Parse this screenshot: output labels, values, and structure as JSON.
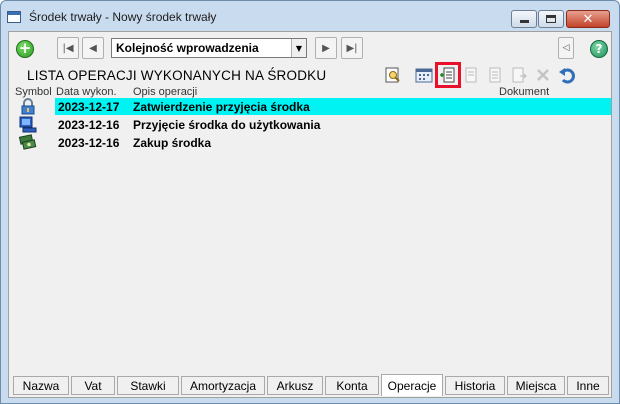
{
  "window": {
    "title": "Środek trwały - Nowy środek trwały"
  },
  "toolbar": {
    "sort_value": "Kolejność wprowadzenia"
  },
  "list": {
    "title": "LISTA OPERACJI WYKONANYCH NA ŚRODKU",
    "columns": {
      "symbol": "Symbol",
      "date": "Data wykon.",
      "desc": "Opis operacji",
      "doc": "Dokument"
    },
    "rows": [
      {
        "date": "2023-12-17",
        "desc": "Zatwierdzenie przyjęcia środka",
        "icon": "lock-icon",
        "selected": true
      },
      {
        "date": "2023-12-16",
        "desc": "Przyjęcie środka do użytkowania",
        "icon": "computer-icon",
        "selected": false
      },
      {
        "date": "2023-12-16",
        "desc": "Zakup środka",
        "icon": "money-icon",
        "selected": false
      }
    ]
  },
  "tabs": [
    "Nazwa",
    "Vat",
    "Stawki",
    "Amortyzacja",
    "Arkusz",
    "Konta",
    "Operacje",
    "Historia",
    "Miejsca",
    "Inne"
  ],
  "active_tab": "Operacje",
  "colors": {
    "selection": "#00f3f3",
    "highlight": "#e8102a"
  }
}
